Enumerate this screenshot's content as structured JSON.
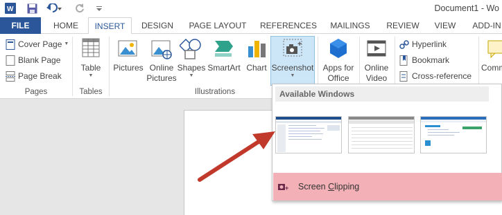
{
  "title_bar": {
    "document_title": "Document1 - Wo"
  },
  "tabs": [
    {
      "label": "FILE"
    },
    {
      "label": "HOME"
    },
    {
      "label": "INSERT"
    },
    {
      "label": "DESIGN"
    },
    {
      "label": "PAGE LAYOUT"
    },
    {
      "label": "REFERENCES"
    },
    {
      "label": "MAILINGS"
    },
    {
      "label": "REVIEW"
    },
    {
      "label": "VIEW"
    },
    {
      "label": "ADD-IN"
    }
  ],
  "ribbon": {
    "pages": {
      "cover_page": "Cover Page",
      "blank_page": "Blank Page",
      "page_break": "Page Break",
      "group_label": "Pages"
    },
    "tables": {
      "table": "Table",
      "group_label": "Tables"
    },
    "illustrations": {
      "pictures": "Pictures",
      "online_pictures_1": "Online",
      "online_pictures_2": "Pictures",
      "shapes": "Shapes",
      "smartart": "SmartArt",
      "chart": "Chart",
      "screenshot": "Screenshot",
      "group_label": "Illustrations"
    },
    "apps": {
      "apps_1": "Apps for",
      "apps_2": "Office"
    },
    "media": {
      "online_video_1": "Online",
      "online_video_2": "Video"
    },
    "links": {
      "hyperlink": "Hyperlink",
      "bookmark": "Bookmark",
      "cross_reference": "Cross-reference"
    },
    "comments": {
      "comment": "Comm"
    }
  },
  "screenshot_menu": {
    "header": "Available Windows",
    "clip_prefix": "Screen ",
    "clip_mnemonic": "C",
    "clip_suffix": "lipping"
  },
  "colors": {
    "file_tab": "#2b579a",
    "active_tab_text": "#2b579a",
    "highlight": "#cde6f7",
    "clipping_highlight": "#f3b0b6",
    "arrow": "#c0392b"
  }
}
